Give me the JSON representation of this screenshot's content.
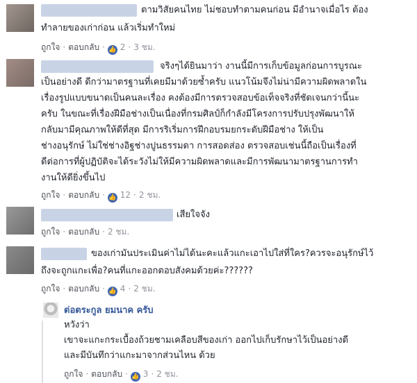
{
  "colors": {
    "link": "#365899",
    "meta": "#90949c",
    "like": "#4267b2",
    "redacted_name": "#c9d3e6"
  },
  "actions": {
    "like": "ถูกใจ",
    "reply": "ตอบกลับ",
    "separator": "·"
  },
  "comments": [
    {
      "lines": [
        "ตามวิสัยคนไทย ไม่ชอบทำตามคนก่อน มีอำนาจเมื่อไร ต้อง",
        "ทำลายของเก่าก่อน แล้วเริ่มทำใหม่"
      ],
      "likes": "2",
      "time": "3 ชม."
    },
    {
      "lines": [
        "จริงๆได้ยินมาว่า งานนี้มีการเก็บข้อมูลก่อนการบูรณะ",
        "เป็นอย่างดี ดีกว่ามาตรฐานที่เคยมีมาด้วยซ้ำครับ แนวโน้มจึงไม่น่ามีความผิดพลาดใน",
        "เรื่องรูปแบบขนาดเป็นคนละเรื่อง คงต้องมีการตรวจสอบข้อเท็จจริงที่ชัดเจนกว่านี้นะ",
        "ครับ ในขณะที่เรื่องฝีมือช่างเป็นเนื่องที่กรมศิลป์ก็กำลังมีโครงการปรับปรุงพัฒนาให้",
        "กลับมามีคุณภาพให้ดีที่สุด มีการริเริ่มการฝึกอบรมยกระดับฝีมือช่าง ให้เป็น",
        "ช่างอนุรักษ์ ไม่ใช่ช่างอิฐช่างปูนธรรมดา การสอดส่อง ตรวจสอบเช่นนี้ถือเป็นเรื่องที่",
        "ดีต่อการที่ผู้ปฏิบัติจะได้ระวังไม่ให้มีความผิดพลาดและมีการพัฒนามาตรฐานการทำ",
        "งานให้ดียิ่งขึ้นไป"
      ],
      "likes": "12",
      "time": "2 ชม."
    },
    {
      "lines": [
        "เสียใจจัง"
      ],
      "time": "2 ชม."
    },
    {
      "lines": [
        "ของเก่ามันประเมินค่าไม่ได้นะคะแล้วแกะเอาไปใส่ที่ใคร?ควรจะอนุรักษ์ไว้",
        "ถึงจะถูกแกะเพื่อ?คนที่แกะออกตอบสังคมด้วยค่ะ??????"
      ],
      "likes": "4",
      "time": "2 ชม."
    }
  ],
  "reply": {
    "author": "ต่อตระกูล ยมนาค ครับ",
    "lines": [
      "หวังว่า",
      "เขาจะแกะกระเบื้องถ้วยชามเคลือบสีของเก่า ออกไปเก็บรักษาไว้เป็นอย่างดี",
      "และมีบันทึกว่าแกะมาจากส่วนไหน ด้วย"
    ],
    "likes": "3",
    "time": "2 ชม."
  }
}
